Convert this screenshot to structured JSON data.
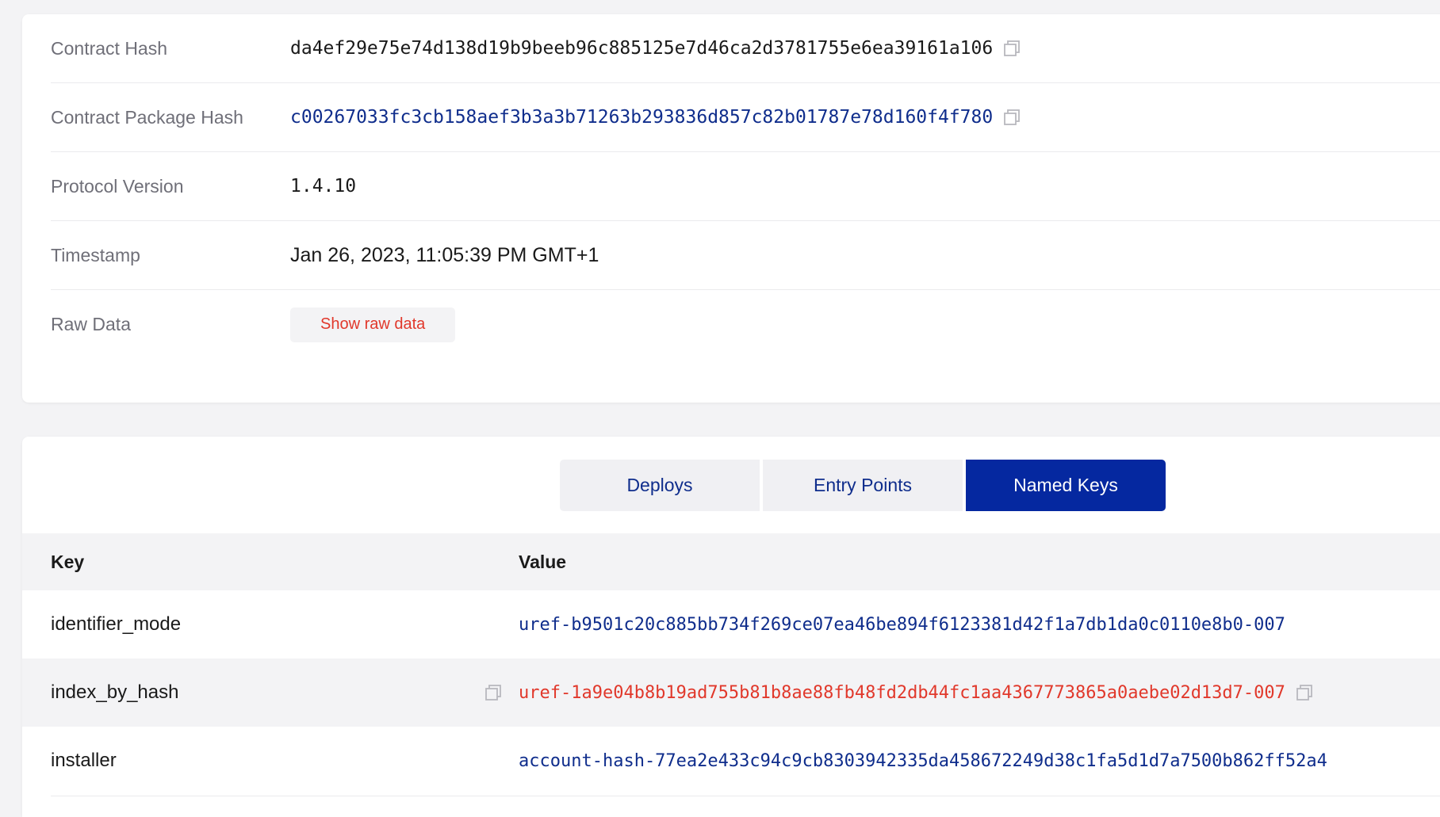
{
  "info": {
    "contract_hash": {
      "label": "Contract Hash",
      "value": "da4ef29e75e74d138d19b9beeb96c885125e7d46ca2d3781755e6ea39161a106"
    },
    "package_hash": {
      "label": "Contract Package Hash",
      "value": "c00267033fc3cb158aef3b3a3b71263b293836d857c82b01787e78d160f4f780"
    },
    "protocol": {
      "label": "Protocol Version",
      "value": "1.4.10"
    },
    "timestamp": {
      "label": "Timestamp",
      "value": "Jan 26, 2023, 11:05:39 PM GMT+1"
    },
    "raw": {
      "label": "Raw Data",
      "button": "Show raw data"
    }
  },
  "tabs": [
    {
      "label": "Deploys",
      "active": false
    },
    {
      "label": "Entry Points",
      "active": false
    },
    {
      "label": "Named Keys",
      "active": true
    }
  ],
  "table": {
    "headers": {
      "key": "Key",
      "value": "Value"
    },
    "rows": [
      {
        "key": "identifier_mode",
        "value": "uref-b9501c20c885bb734f269ce07ea46be894f6123381d42f1a7db1da0c0110e8b0-007"
      },
      {
        "key": "index_by_hash",
        "value": "uref-1a9e04b8b19ad755b81b8ae88fb48fd2db44fc1aa4367773865a0aebe02d13d7-007"
      },
      {
        "key": "installer",
        "value": "account-hash-77ea2e433c94c9cb8303942335da458672249d38c1fa5d1d7a7500b862ff52a4"
      }
    ]
  },
  "colors": {
    "link": "#0f2d8c",
    "accent_red": "#e1382b",
    "active_tab": "#0528a0",
    "muted_label": "#6f6f78"
  },
  "icons": {
    "copy": "copy-icon"
  }
}
